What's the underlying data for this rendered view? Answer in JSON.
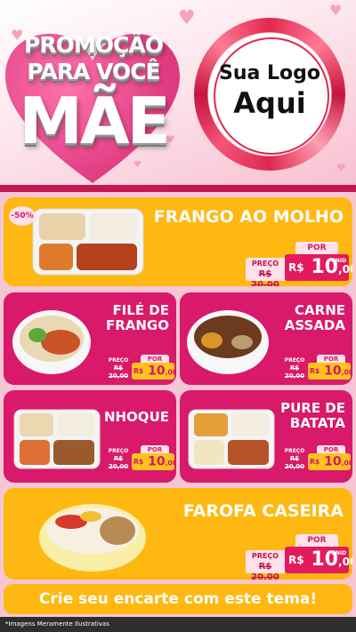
{
  "header": {
    "promo_line1": "PROMOÇÃO",
    "promo_line2": "PARA VOCÊ",
    "promo_line3": "MÃE",
    "logo_line1": "Sua Logo",
    "logo_line2": "Aqui"
  },
  "colors": {
    "yellow": "#ffb811",
    "magenta": "#d9196a",
    "pink_bg": "#f6c6d4",
    "red": "#e31b5c"
  },
  "price_common": {
    "label_por": "POR",
    "label_preco": "PREÇO",
    "old_price": "R$ 20,00",
    "old_value": "20",
    "old_cents": "00",
    "unid": "UNID",
    "currency": "R$",
    "new_integer": "10",
    "new_decimal": ",00"
  },
  "products": [
    {
      "name": "FRANGO AO MOLHO",
      "discount": "-50%"
    },
    {
      "name_line1": "FILÉ DE",
      "name_line2": "FRANGO"
    },
    {
      "name_line1": "CARNE",
      "name_line2": "ASSADA"
    },
    {
      "name": "NHOQUE"
    },
    {
      "name_line1": "PURE DE",
      "name_line2": "BATATA"
    },
    {
      "name": "FAROFA CASEIRA"
    }
  ],
  "cta": "Crie seu encarte com este tema!",
  "footer_note": "*Imagens Meramente Ilustrativas"
}
